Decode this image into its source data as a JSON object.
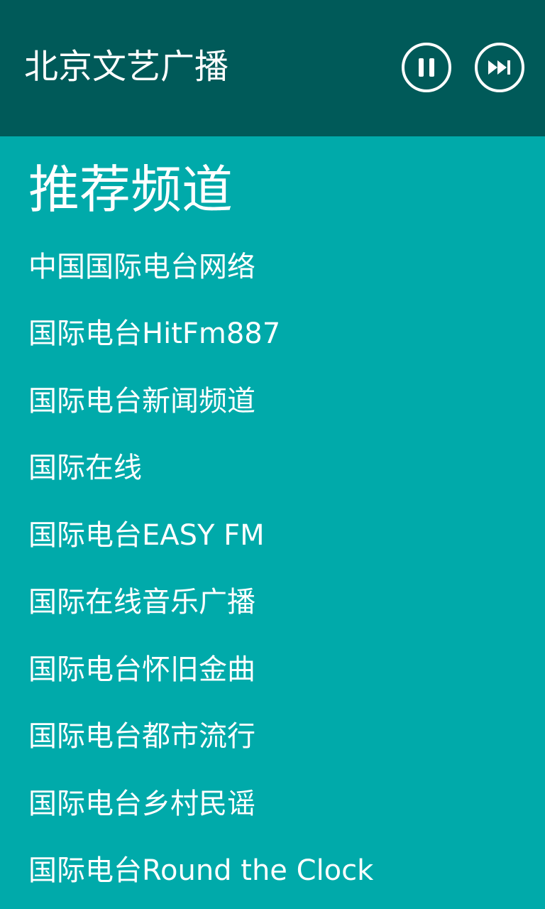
{
  "header": {
    "title": "北京文艺广播",
    "controls": [
      {
        "icon": "pause-icon",
        "label": "Pause"
      },
      {
        "icon": "skip-next-icon",
        "label": "Next"
      }
    ]
  },
  "section": {
    "title": "推荐频道"
  },
  "channels": [
    "中国国际电台网络",
    "国际电台HitFm887",
    "国际电台新闻频道",
    "国际在线",
    "国际电台EASY FM",
    "国际在线音乐广播",
    "国际电台怀旧金曲",
    "国际电台都市流行",
    "国际电台乡村民谣",
    "国际电台Round the Clock"
  ],
  "colors": {
    "header_bg": "#005A59",
    "page_bg": "#00AAAA",
    "text": "#FFFFFF"
  }
}
